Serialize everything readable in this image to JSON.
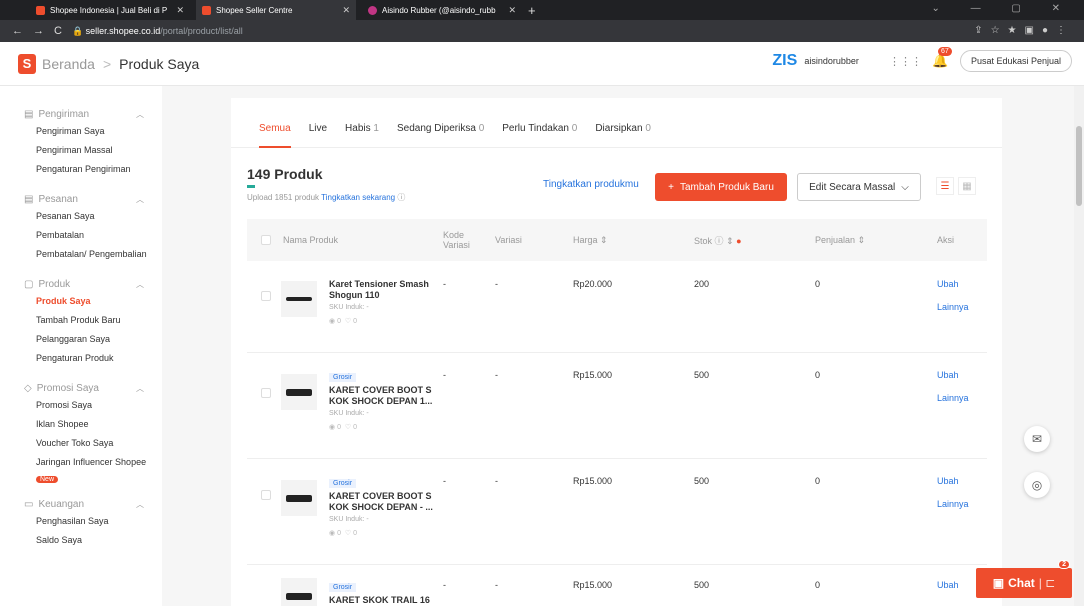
{
  "browser": {
    "tabs": [
      {
        "title": "Shopee Indonesia | Jual Beli di P"
      },
      {
        "title": "Shopee Seller Centre"
      },
      {
        "title": "Aisindo Rubber (@aisindo_rubb"
      }
    ],
    "url_host": "seller.shopee.co.id",
    "url_path": "/portal/product/list/all"
  },
  "header": {
    "breadcrumb_home": "Beranda",
    "breadcrumb_sep": ">",
    "breadcrumb_current": "Produk Saya",
    "shop_name": "aisindorubber",
    "notif_count": "67",
    "edu_button": "Pusat Edukasi Penjual"
  },
  "sidebar": {
    "sections": [
      {
        "title": "Pengiriman",
        "items": [
          "Pengiriman Saya",
          "Pengiriman Massal",
          "Pengaturan Pengiriman"
        ]
      },
      {
        "title": "Pesanan",
        "items": [
          "Pesanan Saya",
          "Pembatalan",
          "Pembatalan/ Pengembalian"
        ]
      },
      {
        "title": "Produk",
        "items": [
          "Produk Saya",
          "Tambah Produk Baru",
          "Pelanggaran Saya",
          "Pengaturan Produk"
        ]
      },
      {
        "title": "Promosi Saya",
        "items": [
          "Promosi Saya",
          "Iklan Shopee",
          "Voucher Toko Saya",
          "Jaringan Influencer Shopee"
        ],
        "new_badge": "New"
      },
      {
        "title": "Keuangan",
        "items": [
          "Penghasilan Saya",
          "Saldo Saya"
        ]
      }
    ]
  },
  "main": {
    "tabs": [
      {
        "label": "Semua",
        "count": ""
      },
      {
        "label": "Live",
        "count": ""
      },
      {
        "label": "Habis",
        "count": "1"
      },
      {
        "label": "Sedang Diperiksa",
        "count": "0"
      },
      {
        "label": "Perlu Tindakan",
        "count": "0"
      },
      {
        "label": "Diarsipkan",
        "count": "0"
      }
    ],
    "product_count": "149 Produk",
    "upload_text": "Upload 1851 produk",
    "upload_link": "Tingkatkan sekarang",
    "improve_link": "Tingkatkan produkmu",
    "add_button": "Tambah Produk Baru",
    "mass_edit_button": "Edit Secara Massal",
    "columns": {
      "name": "Nama Produk",
      "code": "Kode Variasi",
      "variation": "Variasi",
      "price": "Harga",
      "stock": "Stok",
      "sales": "Penjualan",
      "action": "Aksi"
    },
    "rows": [
      {
        "grosir": "",
        "name": "Karet Tensioner Smash Shogun 110",
        "sku": "SKU Induk: -",
        "views": "0",
        "likes": "0",
        "code": "-",
        "variation": "-",
        "price": "Rp20.000",
        "stock": "200",
        "sales": "0",
        "edit": "Ubah",
        "more": "Lainnya"
      },
      {
        "grosir": "Grosir",
        "name": "KARET COVER BOOT S KOK SHOCK DEPAN 1...",
        "sku": "SKU Induk: -",
        "views": "0",
        "likes": "0",
        "code": "-",
        "variation": "-",
        "price": "Rp15.000",
        "stock": "500",
        "sales": "0",
        "edit": "Ubah",
        "more": "Lainnya"
      },
      {
        "grosir": "Grosir",
        "name": "KARET COVER BOOT S KOK SHOCK DEPAN - ...",
        "sku": "SKU Induk: -",
        "views": "0",
        "likes": "0",
        "code": "-",
        "variation": "-",
        "price": "Rp15.000",
        "stock": "500",
        "sales": "0",
        "edit": "Ubah",
        "more": "Lainnya"
      },
      {
        "grosir": "Grosir",
        "name": "KARET SKOK TRAIL 16",
        "sku": "",
        "views": "",
        "likes": "",
        "code": "-",
        "variation": "-",
        "price": "Rp15.000",
        "stock": "500",
        "sales": "0",
        "edit": "Ubah",
        "more": ""
      }
    ]
  },
  "chat": {
    "label": "Chat",
    "badge": "2"
  }
}
